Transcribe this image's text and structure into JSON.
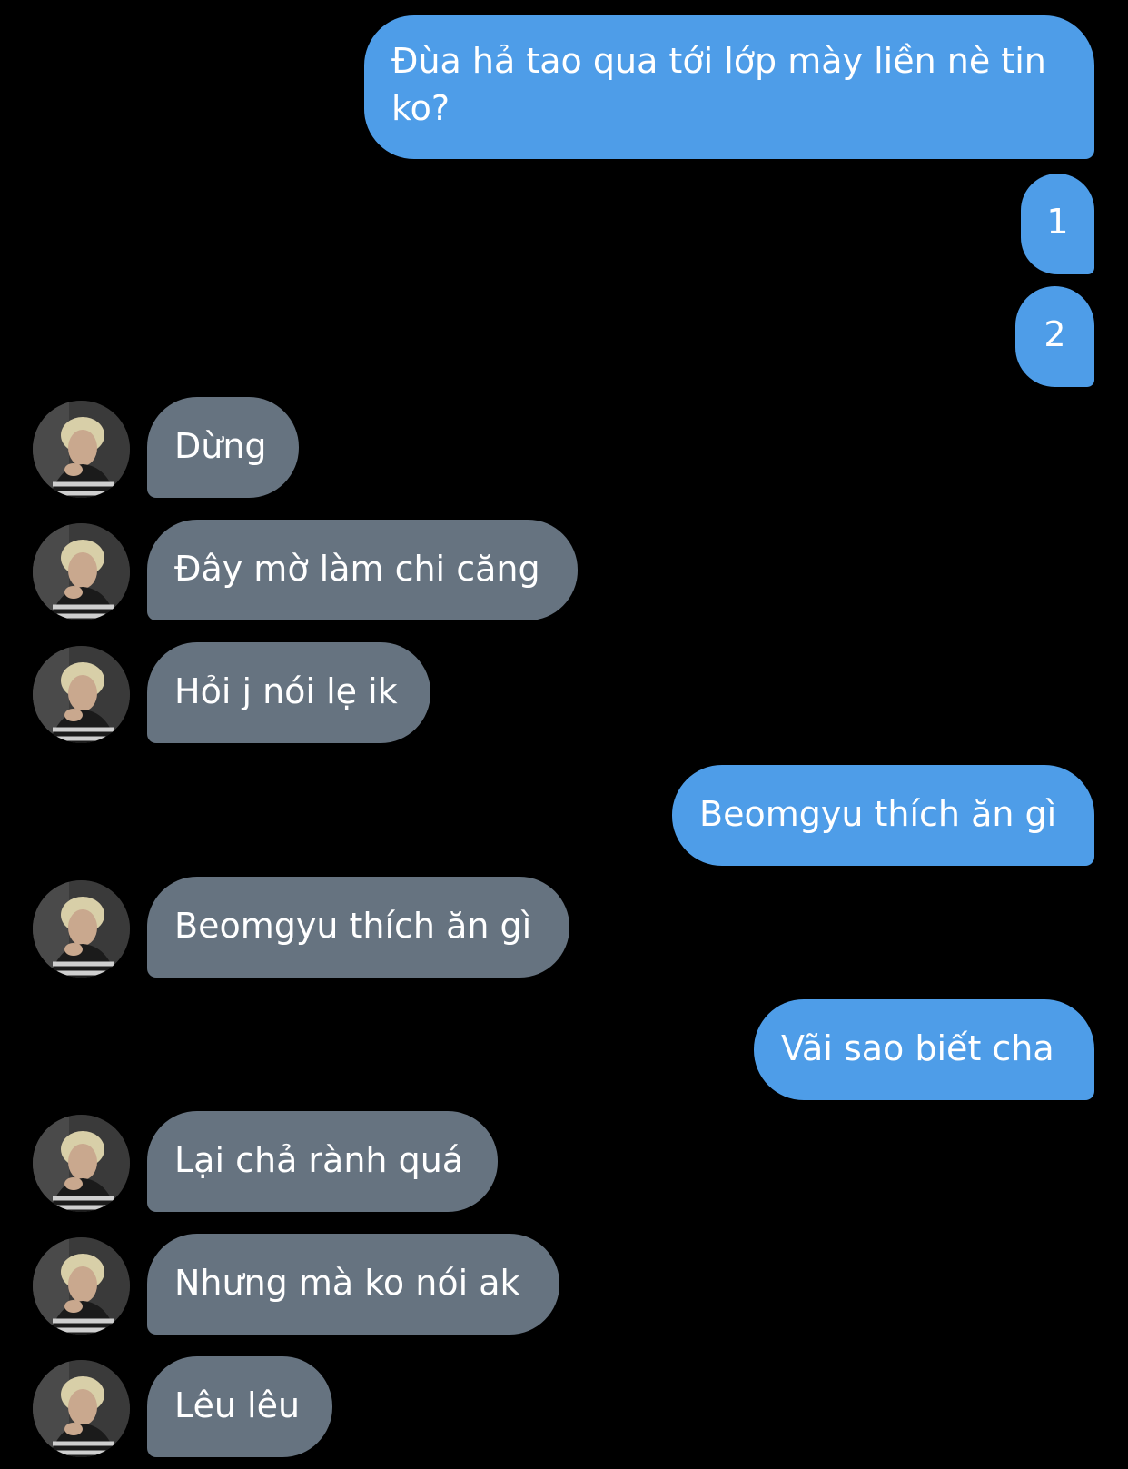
{
  "colors": {
    "background": "#000000",
    "sent_bubble": "#4e9de8",
    "received_bubble": "#667380",
    "text": "#ffffff"
  },
  "messages": [
    {
      "sender": "me",
      "text": "Đùa hả tao qua tới lớp mày liền nè tin ko?"
    },
    {
      "sender": "me",
      "text": "1"
    },
    {
      "sender": "me",
      "text": "2"
    },
    {
      "sender": "them",
      "text": "Dừng",
      "avatar_icon": "profile-photo"
    },
    {
      "sender": "them",
      "text": "Đây mờ làm chi căng",
      "avatar_icon": "profile-photo"
    },
    {
      "sender": "them",
      "text": "Hỏi j nói lẹ ik",
      "avatar_icon": "profile-photo"
    },
    {
      "sender": "me",
      "text": "Beomgyu thích ăn gì"
    },
    {
      "sender": "them",
      "text": "Beomgyu thích ăn gì",
      "avatar_icon": "profile-photo"
    },
    {
      "sender": "me",
      "text": "Vãi sao biết cha"
    },
    {
      "sender": "them",
      "text": "Lại chả rành quá",
      "avatar_icon": "profile-photo"
    },
    {
      "sender": "them",
      "text": "Nhưng mà ko nói ak",
      "avatar_icon": "profile-photo"
    },
    {
      "sender": "them",
      "text": "Lêu lêu",
      "avatar_icon": "profile-photo"
    }
  ]
}
